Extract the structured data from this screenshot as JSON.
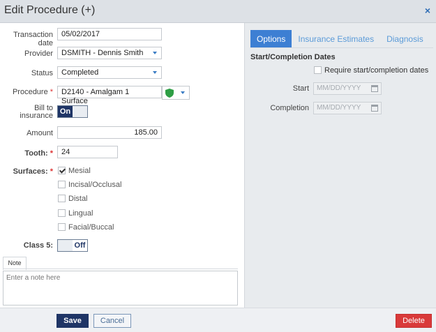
{
  "window": {
    "title": "Edit Procedure (+)",
    "close_glyph": "×"
  },
  "form": {
    "transaction_date": {
      "label": "Transaction date",
      "value": "05/02/2017"
    },
    "provider": {
      "label": "Provider",
      "value": "DSMITH - Dennis Smith"
    },
    "status": {
      "label": "Status",
      "value": "Completed"
    },
    "procedure": {
      "label": "Procedure",
      "required_mark": "*",
      "value": "D2140 - Amalgam 1 Surface",
      "icon": "green-shield-icon"
    },
    "bill_to_insurance": {
      "label_line1": "Bill to",
      "label_line2": "insurance",
      "on_label": "On"
    },
    "amount": {
      "label": "Amount",
      "value": "185.00"
    },
    "tooth": {
      "label": "Tooth:",
      "required_mark": "*",
      "value": "24"
    },
    "surfaces": {
      "label": "Surfaces:",
      "required_mark": "*",
      "options": [
        {
          "label": "Mesial",
          "checked": true
        },
        {
          "label": "Incisal/Occlusal",
          "checked": false
        },
        {
          "label": "Distal",
          "checked": false
        },
        {
          "label": "Lingual",
          "checked": false
        },
        {
          "label": "Facial/Buccal",
          "checked": false
        }
      ]
    },
    "class5": {
      "label": "Class 5:",
      "off_label": "Off"
    },
    "note": {
      "tab_label": "Note",
      "placeholder": "Enter a note here"
    }
  },
  "right_panel": {
    "tabs": [
      {
        "label": "Options",
        "active": true
      },
      {
        "label": "Insurance Estimates",
        "active": false
      },
      {
        "label": "Diagnosis",
        "active": false
      }
    ],
    "section_title": "Start/Completion Dates",
    "require_label": "Require start/completion dates",
    "start": {
      "label": "Start",
      "placeholder": "MM/DD/YYYY"
    },
    "completion": {
      "label": "Completion",
      "placeholder": "MM/DD/YYYY"
    }
  },
  "footer": {
    "save_label": "Save",
    "cancel_label": "Cancel",
    "delete_label": "Delete"
  },
  "colors": {
    "accent": "#3d7fd3",
    "navy": "#1f3566",
    "danger": "#d93a3a",
    "shield": "#2e9e45"
  }
}
